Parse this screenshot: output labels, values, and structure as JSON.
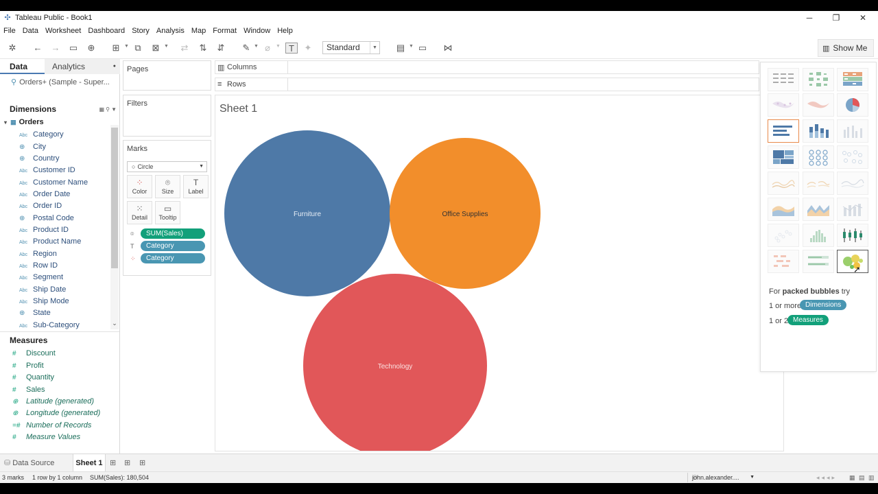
{
  "window": {
    "title": "Tableau Public - Book1"
  },
  "menu": [
    "File",
    "Data",
    "Worksheet",
    "Dashboard",
    "Story",
    "Analysis",
    "Map",
    "Format",
    "Window",
    "Help"
  ],
  "toolbar": {
    "fit_select": "Standard",
    "show_me_label": "Show Me"
  },
  "data_pane": {
    "tab_data": "Data",
    "tab_analytics": "Analytics",
    "datasource": "Orders+ (Sample - Super...",
    "dimensions_heading": "Dimensions",
    "table_name": "Orders",
    "dimensions": [
      {
        "name": "Category",
        "type": "Abc"
      },
      {
        "name": "City",
        "type": "geo"
      },
      {
        "name": "Country",
        "type": "geo"
      },
      {
        "name": "Customer ID",
        "type": "Abc"
      },
      {
        "name": "Customer Name",
        "type": "Abc"
      },
      {
        "name": "Order Date",
        "type": "Abc"
      },
      {
        "name": "Order ID",
        "type": "Abc"
      },
      {
        "name": "Postal Code",
        "type": "geo"
      },
      {
        "name": "Product ID",
        "type": "Abc"
      },
      {
        "name": "Product Name",
        "type": "Abc"
      },
      {
        "name": "Region",
        "type": "Abc"
      },
      {
        "name": "Row ID",
        "type": "Abc"
      },
      {
        "name": "Segment",
        "type": "Abc"
      },
      {
        "name": "Ship Date",
        "type": "Abc"
      },
      {
        "name": "Ship Mode",
        "type": "Abc"
      },
      {
        "name": "State",
        "type": "geo"
      },
      {
        "name": "Sub-Category",
        "type": "Abc"
      }
    ],
    "measures_heading": "Measures",
    "measures": [
      {
        "name": "Discount",
        "italic": false
      },
      {
        "name": "Profit",
        "italic": false
      },
      {
        "name": "Quantity",
        "italic": false
      },
      {
        "name": "Sales",
        "italic": false
      },
      {
        "name": "Latitude (generated)",
        "italic": true
      },
      {
        "name": "Longitude (generated)",
        "italic": true
      },
      {
        "name": "Number of Records",
        "italic": true
      },
      {
        "name": "Measure Values",
        "italic": true
      }
    ]
  },
  "shelves": {
    "pages": "Pages",
    "filters": "Filters",
    "columns": "Columns",
    "rows": "Rows"
  },
  "marks": {
    "title": "Marks",
    "mark_type": "Circle",
    "buttons": [
      "Color",
      "Size",
      "Label",
      "Detail",
      "Tooltip"
    ],
    "pills": [
      {
        "label": "SUM(Sales)",
        "kind": "green",
        "icon": "size-icon"
      },
      {
        "label": "Category",
        "kind": "blue",
        "icon": "label-icon"
      },
      {
        "label": "Category",
        "kind": "blue",
        "icon": "color-icon"
      }
    ]
  },
  "sheet": {
    "title": "Sheet 1"
  },
  "chart_data": {
    "type": "packed_bubbles",
    "size_measure": "SUM(Sales)",
    "bubbles": [
      {
        "label": "Furniture",
        "color": "#4e79a7",
        "text_color": "#e8eef6"
      },
      {
        "label": "Office Supplies",
        "color": "#f28e2b",
        "text_color": "#333333"
      },
      {
        "label": "Technology",
        "color": "#e15759",
        "text_color": "#fbe3e3"
      }
    ]
  },
  "show_me": {
    "hint_prefix": "For ",
    "hint_chart": "packed bubbles",
    "hint_suffix": " try",
    "req1_prefix": "1 or more",
    "req1_pill": "Dimensions",
    "req2_prefix": "1 or 2",
    "req2_pill": "Measures"
  },
  "bottom": {
    "datasource_tab": "Data Source",
    "sheet_tab": "Sheet 1"
  },
  "status": {
    "marks": "3 marks",
    "rows": "1 row by 1 column",
    "sum": "SUM(Sales): 180,504",
    "user": "john.alexander...."
  },
  "colors": {
    "green_pill": "#12a07a",
    "blue_pill": "#4996b2",
    "furniture": "#4e79a7",
    "office_supplies": "#f28e2b",
    "technology": "#e15759"
  }
}
